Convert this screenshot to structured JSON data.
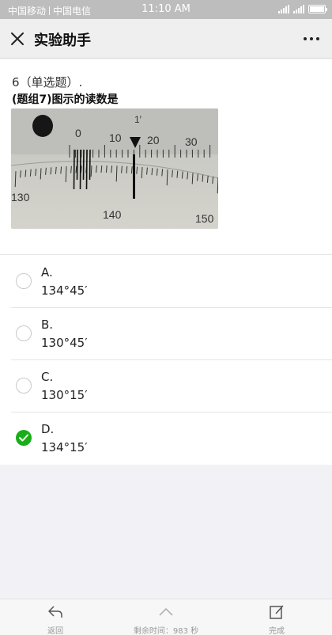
{
  "status_bar": {
    "carrier_1": "中国移动",
    "carrier_2": "中国电信",
    "time": "11:10 AM"
  },
  "nav": {
    "title": "实验助手",
    "close_icon": "close-icon",
    "more_icon": "more-icon"
  },
  "question": {
    "number_label": "6（单选题）.",
    "text": "(题组7)图示的读数是",
    "image": {
      "scale_labels": [
        "130",
        "140",
        "150"
      ],
      "vernier_labels": [
        "0",
        "10",
        "20",
        "30"
      ],
      "unit_mark": "1′"
    }
  },
  "options": [
    {
      "letter": "A.",
      "value": "134°45′",
      "selected": false
    },
    {
      "letter": "B.",
      "value": "130°45′",
      "selected": false
    },
    {
      "letter": "C.",
      "value": "130°15′",
      "selected": false
    },
    {
      "letter": "D.",
      "value": "134°15′",
      "selected": true
    }
  ],
  "bottom_bar": {
    "back_label": "返回",
    "timer_label": "剩余时间：983 秒",
    "done_label": "完成"
  },
  "colors": {
    "selected": "#1aad19",
    "status_bar": "#bdbdbd",
    "page_background": "#f2f1f6"
  }
}
